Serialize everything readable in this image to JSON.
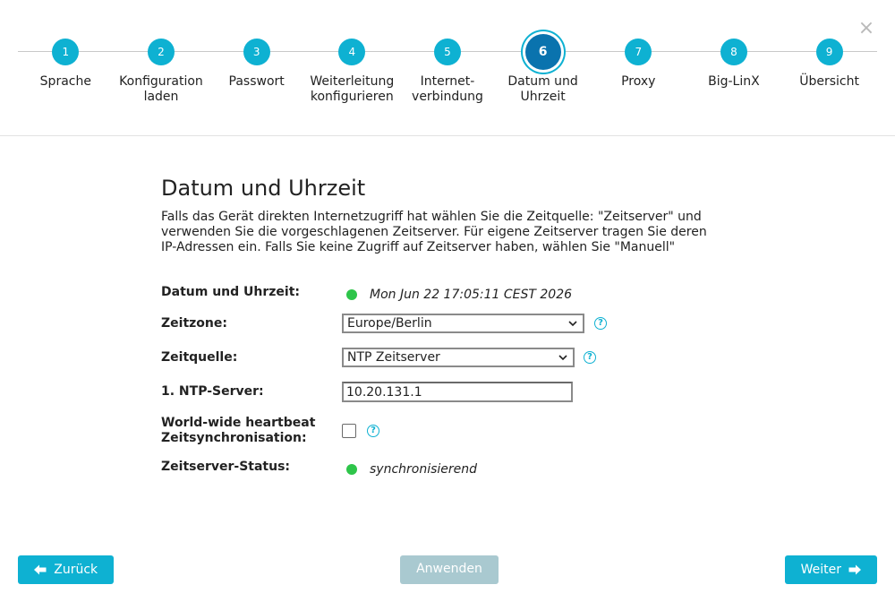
{
  "window": {
    "close_icon": "×"
  },
  "stepper": {
    "steps": [
      {
        "number": "1",
        "label": "Sprache"
      },
      {
        "number": "2",
        "label": "Konfiguration\nladen"
      },
      {
        "number": "3",
        "label": "Passwort"
      },
      {
        "number": "4",
        "label": "Weiterleitung\nkonfigurieren"
      },
      {
        "number": "5",
        "label": "Internet-\nverbindung"
      },
      {
        "number": "6",
        "label": "Datum und\nUhrzeit"
      },
      {
        "number": "7",
        "label": "Proxy"
      },
      {
        "number": "8",
        "label": "Big-LinX"
      },
      {
        "number": "9",
        "label": "Übersicht"
      }
    ],
    "active_step": 6
  },
  "page": {
    "title": "Datum und Uhrzeit",
    "intro": "Falls das Gerät direkten Internetzugriff hat wählen Sie die Zeitquelle: \"Zeitserver\" und verwenden Sie die vorgeschlagenen Zeitserver. Für eigene Zeitserver tragen Sie deren IP-Adressen ein. Falls Sie keine Zugriff auf Zeitserver haben, wählen Sie \"Manuell\""
  },
  "form": {
    "datetime": {
      "label": "Datum und Uhrzeit:",
      "value": "Mon Jun 22 17:05:11 CEST 2026",
      "status_color": "#2ec54a"
    },
    "timezone": {
      "label": "Zeitzone:",
      "value": "Europe/Berlin"
    },
    "timesource": {
      "label": "Zeitquelle:",
      "value": "NTP Zeitserver"
    },
    "ntp_server": {
      "label": "1. NTP-Server:",
      "value": "10.20.131.1"
    },
    "heartbeat": {
      "label": "World-wide heartbeat Zeitsynchronisation:",
      "checked": false
    },
    "server_status": {
      "label": "Zeitserver-Status:",
      "value": "synchronisierend",
      "status_color": "#2ec54a"
    }
  },
  "footer": {
    "back_label": "Zurück",
    "apply_label": "Anwenden",
    "next_label": "Weiter"
  },
  "colors": {
    "accent": "#0eb1d2",
    "active_step": "#0a73ae",
    "disabled_button": "#a9c9d0",
    "status_ok": "#2ec54a"
  }
}
